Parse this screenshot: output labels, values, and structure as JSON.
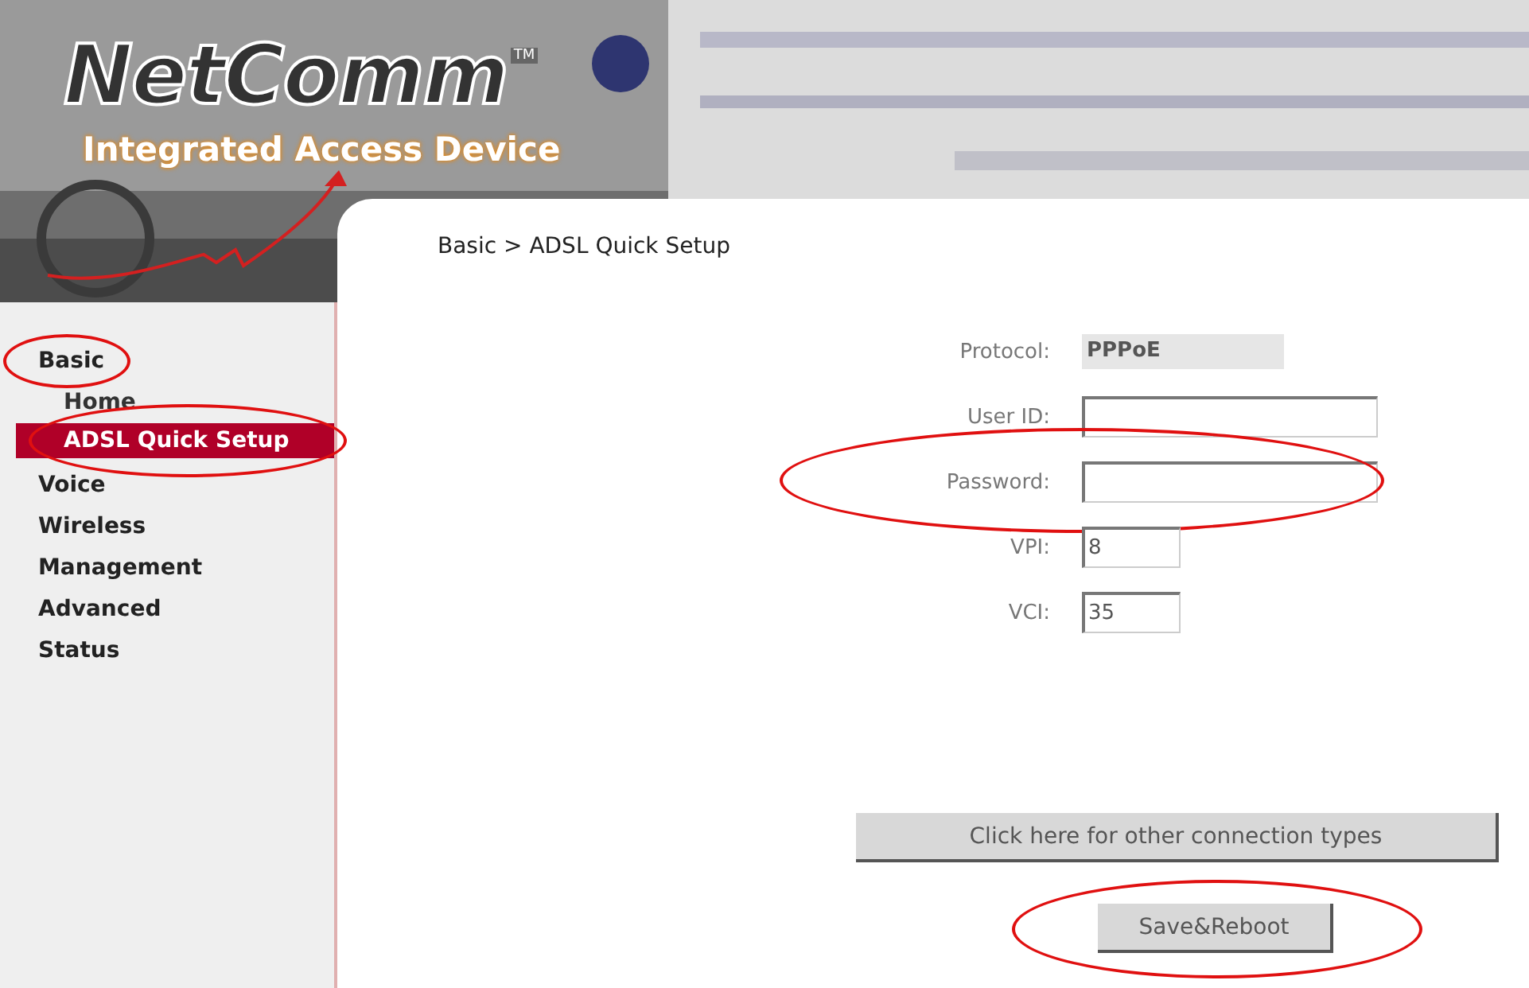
{
  "header": {
    "logo": "NetComm",
    "trademark": "TM",
    "subtitle": "Integrated Access Device"
  },
  "sidebar": {
    "items": [
      {
        "label": "Basic",
        "selected": false,
        "circled": true,
        "children": [
          {
            "label": "Home",
            "selected": false,
            "circled": false
          },
          {
            "label": "ADSL Quick Setup",
            "selected": true,
            "circled": true
          }
        ]
      },
      {
        "label": "Voice",
        "selected": false,
        "circled": false
      },
      {
        "label": "Wireless",
        "selected": false,
        "circled": false
      },
      {
        "label": "Management",
        "selected": false,
        "circled": false
      },
      {
        "label": "Advanced",
        "selected": false,
        "circled": false
      },
      {
        "label": "Status",
        "selected": false,
        "circled": false
      }
    ]
  },
  "breadcrumb": "Basic > ADSL Quick Setup",
  "form": {
    "fields": [
      {
        "kind": "static",
        "label": "Protocol:",
        "value": "PPPoE",
        "circled": false
      },
      {
        "kind": "wide",
        "label": "User ID:",
        "circled": false
      },
      {
        "kind": "wide",
        "label": "Password:",
        "circled": true
      },
      {
        "kind": "short",
        "label": "VPI:",
        "value": "8",
        "circled": false
      },
      {
        "kind": "short",
        "label": "VCI:",
        "value": "35",
        "circled": false
      }
    ]
  },
  "buttons": [
    {
      "kind": "wide",
      "label": "Click here for other connection types",
      "circled": false
    },
    {
      "kind": "normal",
      "label": "Save&Reboot",
      "circled": true
    }
  ]
}
